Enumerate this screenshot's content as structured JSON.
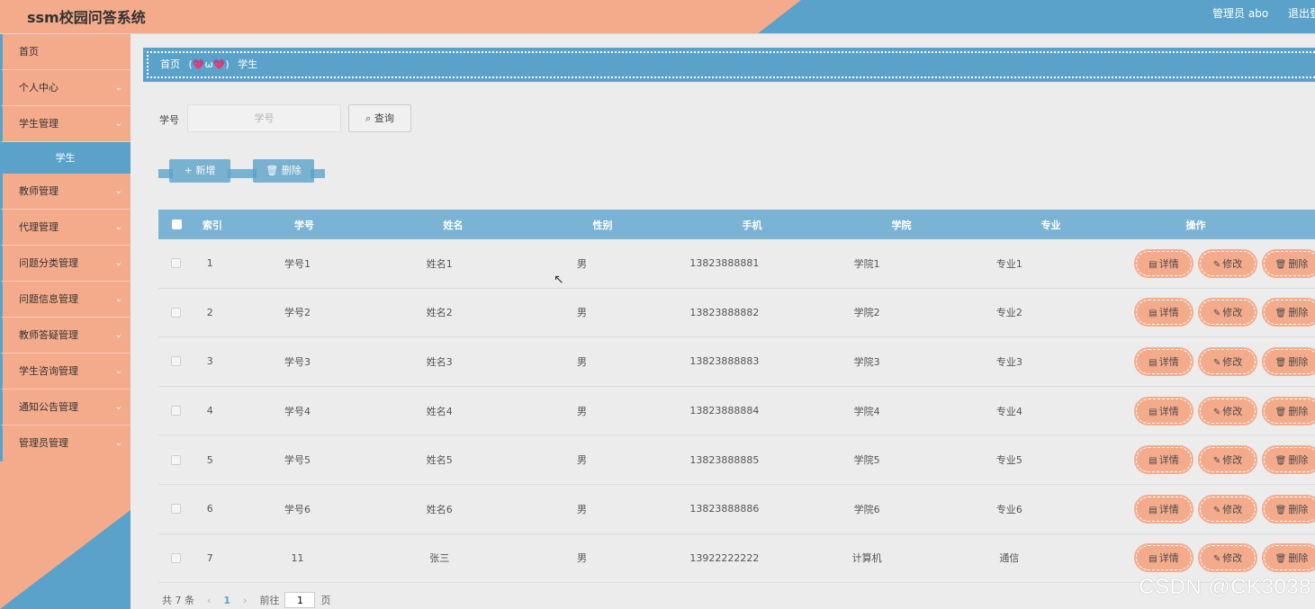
{
  "header": {
    "title": "ssm校园问答系统",
    "admin": "管理员 abo",
    "logout": "退出登录"
  },
  "sidebar": {
    "items": [
      {
        "label": "首页",
        "chevron": ""
      },
      {
        "label": "个人中心",
        "chevron": "⌄"
      },
      {
        "label": "学生管理",
        "chevron": "⌄"
      },
      {
        "label": "教师管理",
        "chevron": "⌄"
      },
      {
        "label": "代理管理",
        "chevron": "⌄"
      },
      {
        "label": "问题分类管理",
        "chevron": "⌄"
      },
      {
        "label": "问题信息管理",
        "chevron": "⌄"
      },
      {
        "label": "教师答疑管理",
        "chevron": "⌄"
      },
      {
        "label": "学生咨询管理",
        "chevron": "⌄"
      },
      {
        "label": "通知公告管理",
        "chevron": "⌄"
      },
      {
        "label": "管理员管理",
        "chevron": "⌄"
      }
    ],
    "sub_active": "学生"
  },
  "breadcrumb": {
    "home": "首页",
    "separator": "(💗ω💗)",
    "current": "学生"
  },
  "search": {
    "label": "学号",
    "placeholder": "学号",
    "button": "查询",
    "button_icon": "search-icon"
  },
  "actions": {
    "add": "+ 新增",
    "delete": "删除"
  },
  "table": {
    "headers": [
      "索引",
      "学号",
      "姓名",
      "性别",
      "手机",
      "学院",
      "专业",
      "操作"
    ],
    "rows": [
      {
        "idx": "1",
        "sno": "学号1",
        "name": "姓名1",
        "sex": "男",
        "phone": "13823888881",
        "college": "学院1",
        "major": "专业1"
      },
      {
        "idx": "2",
        "sno": "学号2",
        "name": "姓名2",
        "sex": "男",
        "phone": "13823888882",
        "college": "学院2",
        "major": "专业2"
      },
      {
        "idx": "3",
        "sno": "学号3",
        "name": "姓名3",
        "sex": "男",
        "phone": "13823888883",
        "college": "学院3",
        "major": "专业3"
      },
      {
        "idx": "4",
        "sno": "学号4",
        "name": "姓名4",
        "sex": "男",
        "phone": "13823888884",
        "college": "学院4",
        "major": "专业4"
      },
      {
        "idx": "5",
        "sno": "学号5",
        "name": "姓名5",
        "sex": "男",
        "phone": "13823888885",
        "college": "学院5",
        "major": "专业5"
      },
      {
        "idx": "6",
        "sno": "学号6",
        "name": "姓名6",
        "sex": "男",
        "phone": "13823888886",
        "college": "学院6",
        "major": "专业6"
      },
      {
        "idx": "7",
        "sno": "11",
        "name": "张三",
        "sex": "男",
        "phone": "13922222222",
        "college": "计算机",
        "major": "通信"
      }
    ],
    "ops": {
      "detail": "详情",
      "edit": "修改",
      "delete": "删除"
    }
  },
  "pagination": {
    "total": "共 7 条",
    "current_page": "1",
    "goto_label": "前往",
    "goto_value": "1",
    "page_suffix": "页"
  },
  "watermark": "CSDN @CK3038",
  "colors": {
    "salmon": "#f4ab8c",
    "blue": "#5aa2c9",
    "table_header": "#7ab3d4"
  }
}
